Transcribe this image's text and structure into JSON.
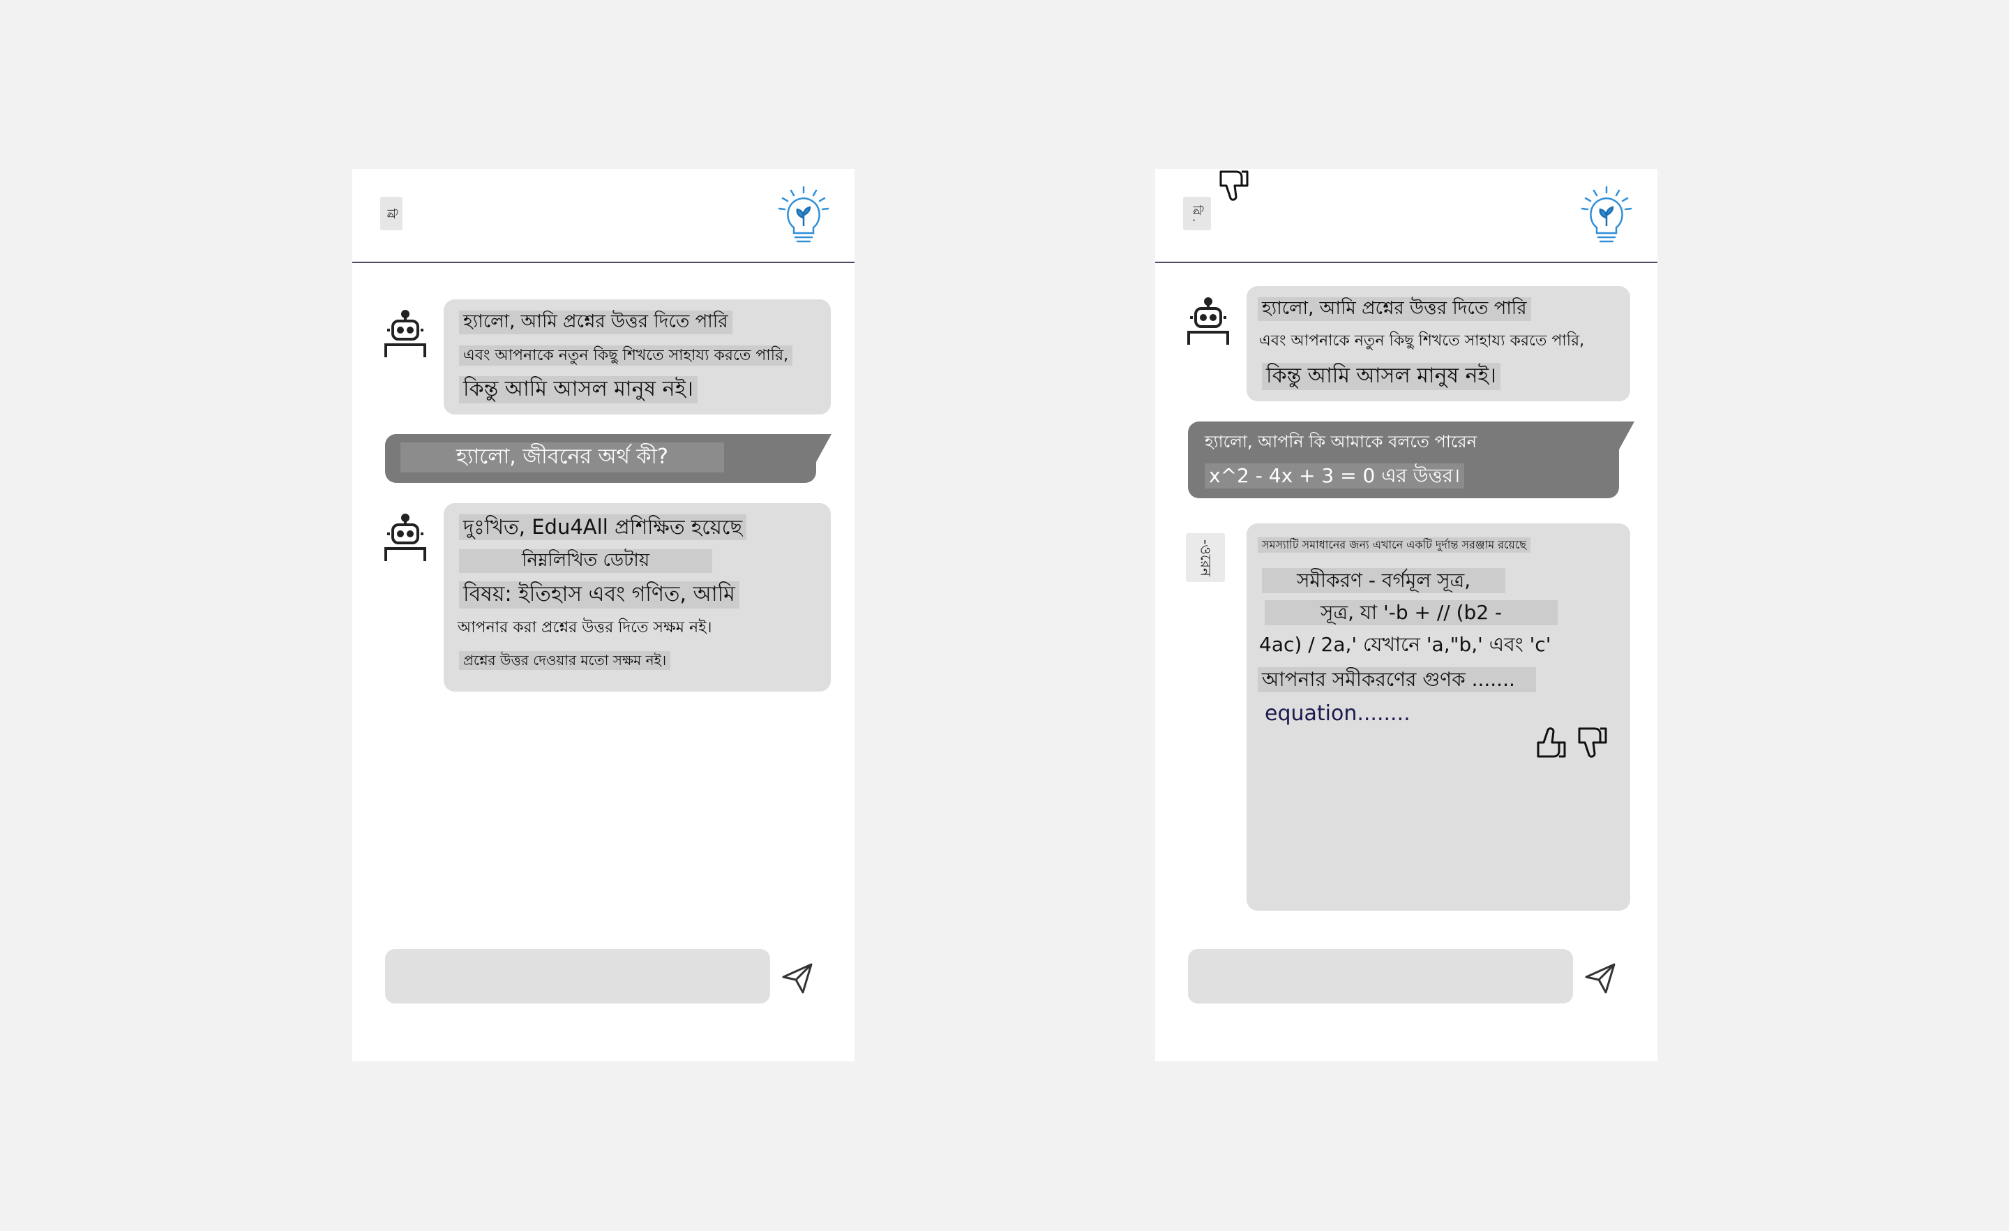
{
  "left_phone": {
    "header_tag": "ৱি",
    "bot_message_1": {
      "line1": "হ্যালো, আমি প্রশ্নের উত্তর দিতে পারি",
      "line2": "এবং আপনাকে নতুন কিছু শিখতে সাহায্য করতে পারি,",
      "line3": "কিন্তু আমি আসল মানুষ নই।"
    },
    "user_message": "হ্যালো, জীবনের অর্থ কী?",
    "bot_message_2": {
      "line1": "দুঃখিত, Edu4All প্রশিক্ষিত হয়েছে",
      "line2": "নিম্নলিখিত ডেটায়",
      "line3": "বিষয়: ইতিহাস এবং গণিত, আমি",
      "line4": "আপনার করা প্রশ্নের উত্তর দিতে সক্ষম নই।",
      "line5": "প্রশ্নের উত্তর দেওয়ার মতো সক্ষম নই।"
    },
    "input_placeholder": ""
  },
  "right_phone": {
    "header_tag": "ৱি .",
    "side_tag": "-ওরেন",
    "bot_message_1": {
      "line1": "হ্যালো, আমি প্রশ্নের উত্তর দিতে পারি",
      "line2": "এবং আপনাকে নতুন কিছু শিখতে সাহায্য করতে পারি,",
      "line3": "কিন্তু আমি আসল মানুষ নই।"
    },
    "user_message": {
      "line1": "হ্যালো, আপনি কি আমাকে বলতে পারেন",
      "line2": "x^2 - 4x + 3 = 0 এর উত্তর।"
    },
    "bot_message_2": {
      "line1": "সমস্যাটি সমাধানের জন্য এখানে একটি দুর্দান্ত সরঞ্জাম রয়েছে",
      "line2": "সমীকরণ - বর্গমূল সূত্র,",
      "line3": "সূত্র, যা '-b + // (b2 -",
      "line4": "4ac) / 2a,' যেখানে 'a,\"b,' এবং 'c'",
      "line5": "আপনার সমীকরণের গুণক .......",
      "line6": "equation........"
    },
    "input_placeholder": ""
  },
  "icons": {
    "bulb": "lightbulb-plant-icon",
    "robot": "robot-icon",
    "send": "send-icon",
    "thumbs_up": "thumbs-up-icon",
    "thumbs_down": "thumbs-down-icon"
  },
  "colors": {
    "background": "#f2f2f2",
    "panel": "#ffffff",
    "bot_bubble": "#dedede",
    "user_bubble": "#7a7a7a",
    "accent": "#2f8fd8",
    "equation_text": "#1a1a4e"
  }
}
